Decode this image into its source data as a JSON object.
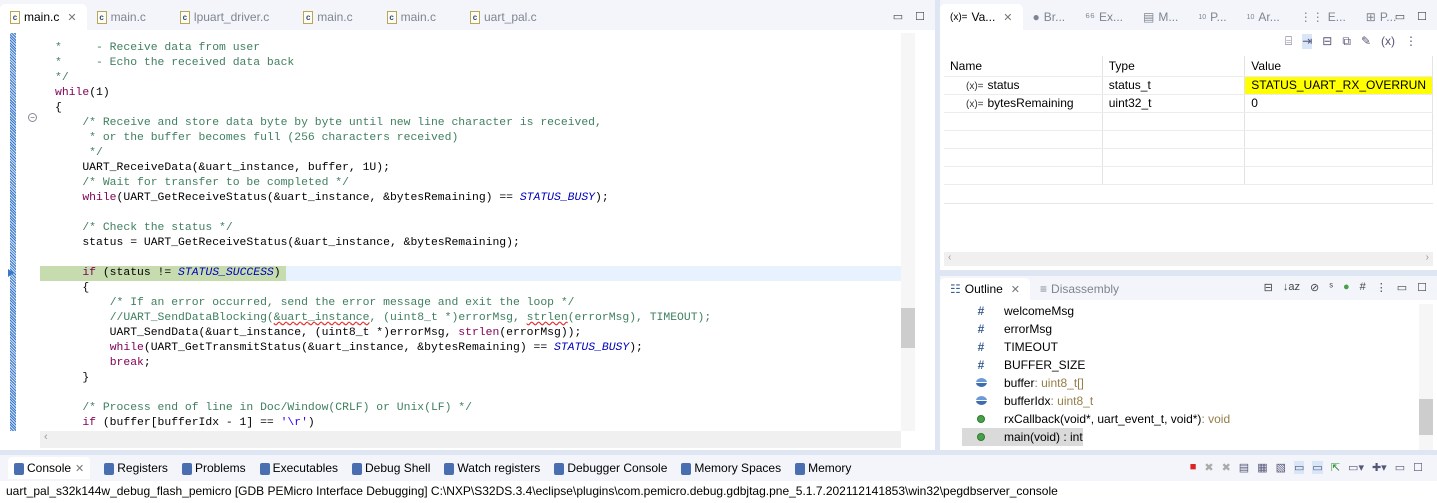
{
  "editor": {
    "tabs": [
      "main.c",
      "main.c",
      "lpuart_driver.c",
      "main.c",
      "main.c",
      "uart_pal.c"
    ],
    "current_line_index": 15,
    "lines": [
      [
        [
          "*     - Receive data from user",
          "cm"
        ]
      ],
      [
        [
          "*     - Echo the received data back",
          "cm"
        ]
      ],
      [
        [
          "*/",
          "cm"
        ]
      ],
      [
        [
          "while",
          "kw"
        ],
        [
          "(1)",
          ""
        ]
      ],
      [
        [
          "{",
          ""
        ]
      ],
      [
        [
          "    ",
          ""
        ],
        [
          "/* Receive and store data byte by byte until new line character is received,",
          "cm"
        ]
      ],
      [
        [
          "     * or the buffer becomes full (256 characters received)",
          "cm"
        ]
      ],
      [
        [
          "     */",
          "cm"
        ]
      ],
      [
        [
          "    UART_ReceiveData(&uart_instance, buffer, 1U);",
          ""
        ]
      ],
      [
        [
          "    ",
          ""
        ],
        [
          "/* Wait for transfer to be completed */",
          "cm"
        ]
      ],
      [
        [
          "    ",
          ""
        ],
        [
          "while",
          "kw"
        ],
        [
          "(UART_GetReceiveStatus(&uart_instance, &bytesRemaining) == ",
          ""
        ],
        [
          "STATUS_BUSY",
          "en"
        ],
        [
          ");",
          ""
        ]
      ],
      [
        [
          "",
          ""
        ]
      ],
      [
        [
          "    ",
          ""
        ],
        [
          "/* Check the status */",
          "cm"
        ]
      ],
      [
        [
          "    status = UART_GetReceiveStatus(&uart_instance, &bytesRemaining);",
          ""
        ]
      ],
      [
        [
          "",
          ""
        ]
      ],
      [
        [
          "    ",
          ""
        ],
        [
          "if",
          "kw"
        ],
        [
          " (status != ",
          ""
        ],
        [
          "STATUS_SUCCESS",
          "en"
        ],
        [
          ")",
          ""
        ]
      ],
      [
        [
          "    {",
          ""
        ]
      ],
      [
        [
          "        ",
          ""
        ],
        [
          "/* If an error occurred, send the error message and exit the loop */",
          "cm"
        ]
      ],
      [
        [
          "        ",
          ""
        ],
        [
          "//UART_SendDataBlocking(",
          "cm"
        ],
        [
          "&uart_instance",
          "cm sq"
        ],
        [
          ", (uint8_t *)errorMsg, ",
          "cm"
        ],
        [
          "strlen",
          "cm sq"
        ],
        [
          "(errorMsg), TIMEOUT);",
          "cm"
        ]
      ],
      [
        [
          "        UART_SendData(&uart_instance, (uint8_t *)errorMsg, ",
          ""
        ],
        [
          "strlen",
          "kw"
        ],
        [
          "(errorMsg));",
          ""
        ]
      ],
      [
        [
          "        ",
          ""
        ],
        [
          "while",
          "kw"
        ],
        [
          "(UART_GetTransmitStatus(&uart_instance, &bytesRemaining) == ",
          ""
        ],
        [
          "STATUS_BUSY",
          "en"
        ],
        [
          ");",
          ""
        ]
      ],
      [
        [
          "        ",
          ""
        ],
        [
          "break",
          "kw"
        ],
        [
          ";",
          ""
        ]
      ],
      [
        [
          "    }",
          ""
        ]
      ],
      [
        [
          "",
          ""
        ]
      ],
      [
        [
          "    ",
          ""
        ],
        [
          "/* Process end of line in Doc/Window(CRLF) or Unix(LF) */",
          "cm"
        ]
      ],
      [
        [
          "    ",
          ""
        ],
        [
          "if",
          "kw"
        ],
        [
          " (buffer[bufferIdx - 1] == ",
          ""
        ],
        [
          "'\\r'",
          "st"
        ],
        [
          ")",
          ""
        ]
      ],
      [
        [
          "    {",
          ""
        ]
      ]
    ]
  },
  "variables": {
    "tabs": [
      "Va...",
      "Br...",
      "Ex...",
      "M...",
      "P...",
      "Ar...",
      "E...",
      "P..."
    ],
    "columns": [
      "Name",
      "Type",
      "Value"
    ],
    "rows": [
      {
        "name": "status",
        "type": "status_t",
        "value": "STATUS_UART_RX_OVERRUN",
        "changed": true
      },
      {
        "name": "bytesRemaining",
        "type": "uint32_t",
        "value": "0",
        "changed": false
      }
    ],
    "var_icon": "(x)="
  },
  "outline": {
    "tabs": [
      "Outline",
      "Disassembly"
    ],
    "items": [
      {
        "icon": "macro",
        "label": "welcomeMsg",
        "type": ""
      },
      {
        "icon": "macro",
        "label": "errorMsg",
        "type": ""
      },
      {
        "icon": "macro",
        "label": "TIMEOUT",
        "type": ""
      },
      {
        "icon": "macro",
        "label": "BUFFER_SIZE",
        "type": ""
      },
      {
        "icon": "variable",
        "label": "buffer",
        "type": " : uint8_t[]"
      },
      {
        "icon": "variable",
        "label": "bufferIdx",
        "type": " : uint8_t"
      },
      {
        "icon": "function",
        "label": "rxCallback(void*, uart_event_t, void*)",
        "type": " : void"
      },
      {
        "icon": "function",
        "label": "main(void) : int",
        "type": "",
        "selected": true
      }
    ]
  },
  "console": {
    "tabs": [
      "Console",
      "Registers",
      "Problems",
      "Executables",
      "Debug Shell",
      "Watch registers",
      "Debugger Console",
      "Memory Spaces",
      "Memory"
    ],
    "text": "uart_pal_s32k144w_debug_flash_pemicro [GDB PEMicro Interface Debugging] C:\\NXP\\S32DS.3.4\\eclipse\\plugins\\com.pemicro.debug.gdbjtag.pne_5.1.7.202112141853\\win32\\pegdbserver_console"
  }
}
